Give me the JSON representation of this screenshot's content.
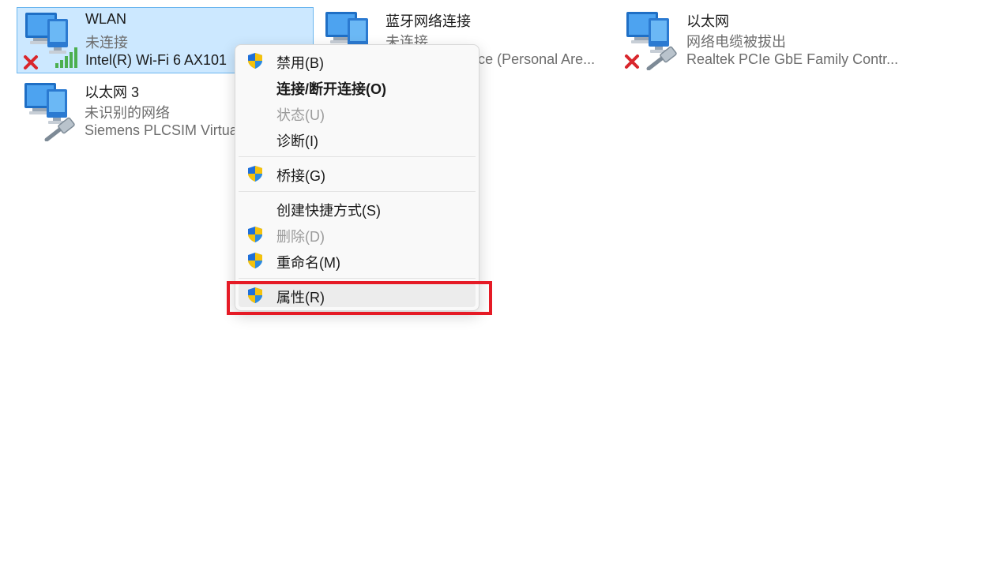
{
  "adapters": [
    {
      "name": "WLAN",
      "status": "未连接",
      "device": "Intel(R) Wi-Fi 6 AX101",
      "icon": "wifi-adapter-icon"
    },
    {
      "name": "蓝牙网络连接",
      "status": "未连接",
      "device": "Bluetooth Device (Personal Are...",
      "icon": "bluetooth-adapter-icon"
    },
    {
      "name": "以太网",
      "status": "网络电缆被拔出",
      "device": "Realtek PCIe GbE Family Contr...",
      "icon": "ethernet-adapter-icon"
    },
    {
      "name": "以太网 3",
      "status": "未识别的网络",
      "device": "Siemens PLCSIM Virtual Ethernet Adapter",
      "icon": "ethernet-adapter-icon"
    }
  ],
  "context_menu": {
    "disable": "禁用(B)",
    "connect_disconnect": "连接/断开连接(O)",
    "status": "状态(U)",
    "diagnose": "诊断(I)",
    "bridge": "桥接(G)",
    "create_shortcut": "创建快捷方式(S)",
    "delete": "删除(D)",
    "rename": "重命名(M)",
    "properties": "属性(R)"
  },
  "colors": {
    "selection_bg": "#cce8ff",
    "selection_border": "#6bb6ef",
    "highlight_border": "#e51a25",
    "disabled_text": "#9b9b9b"
  }
}
